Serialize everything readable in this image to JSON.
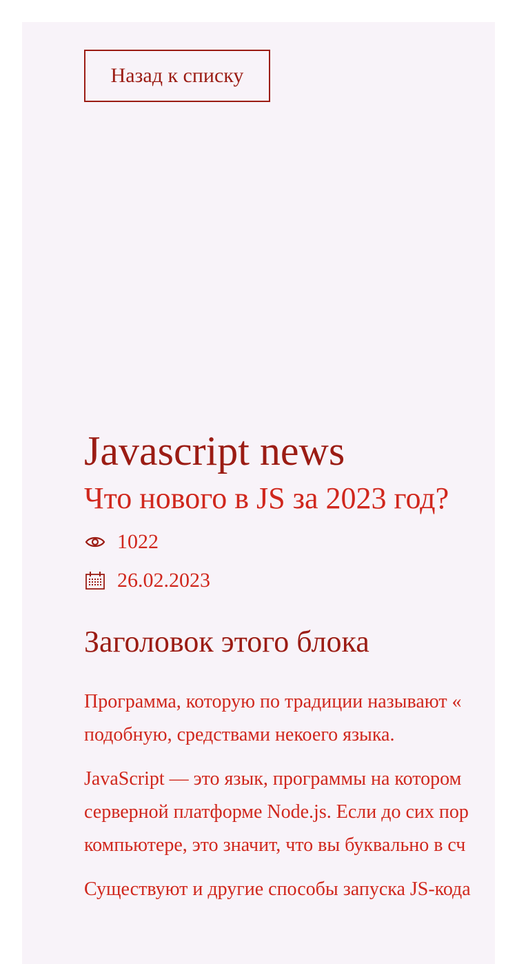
{
  "back_button": {
    "label": "Назад к списку"
  },
  "category": {
    "title": "Javascript news"
  },
  "article": {
    "title": "Что нового в JS за 2023 год?",
    "views": "1022",
    "date": "26.02.2023",
    "section_heading": "Заголовок этого блока",
    "paragraphs": [
      [
        "Программа, которую по традиции называют «",
        "подобную, средствами некоего языка."
      ],
      [
        "JavaScript — это язык, программы на котором",
        "серверной платформе Node.js. Если до сих пор",
        "компьютере, это значит, что вы буквально в сч"
      ],
      [
        "Существуют и другие способы запуска JS-кода"
      ]
    ]
  },
  "icons": {
    "views": "eye-icon",
    "date": "calendar-icon"
  },
  "colors": {
    "accent_dark": "#9b1c14",
    "accent": "#d0271d",
    "card_background": "#f8f3f9"
  }
}
